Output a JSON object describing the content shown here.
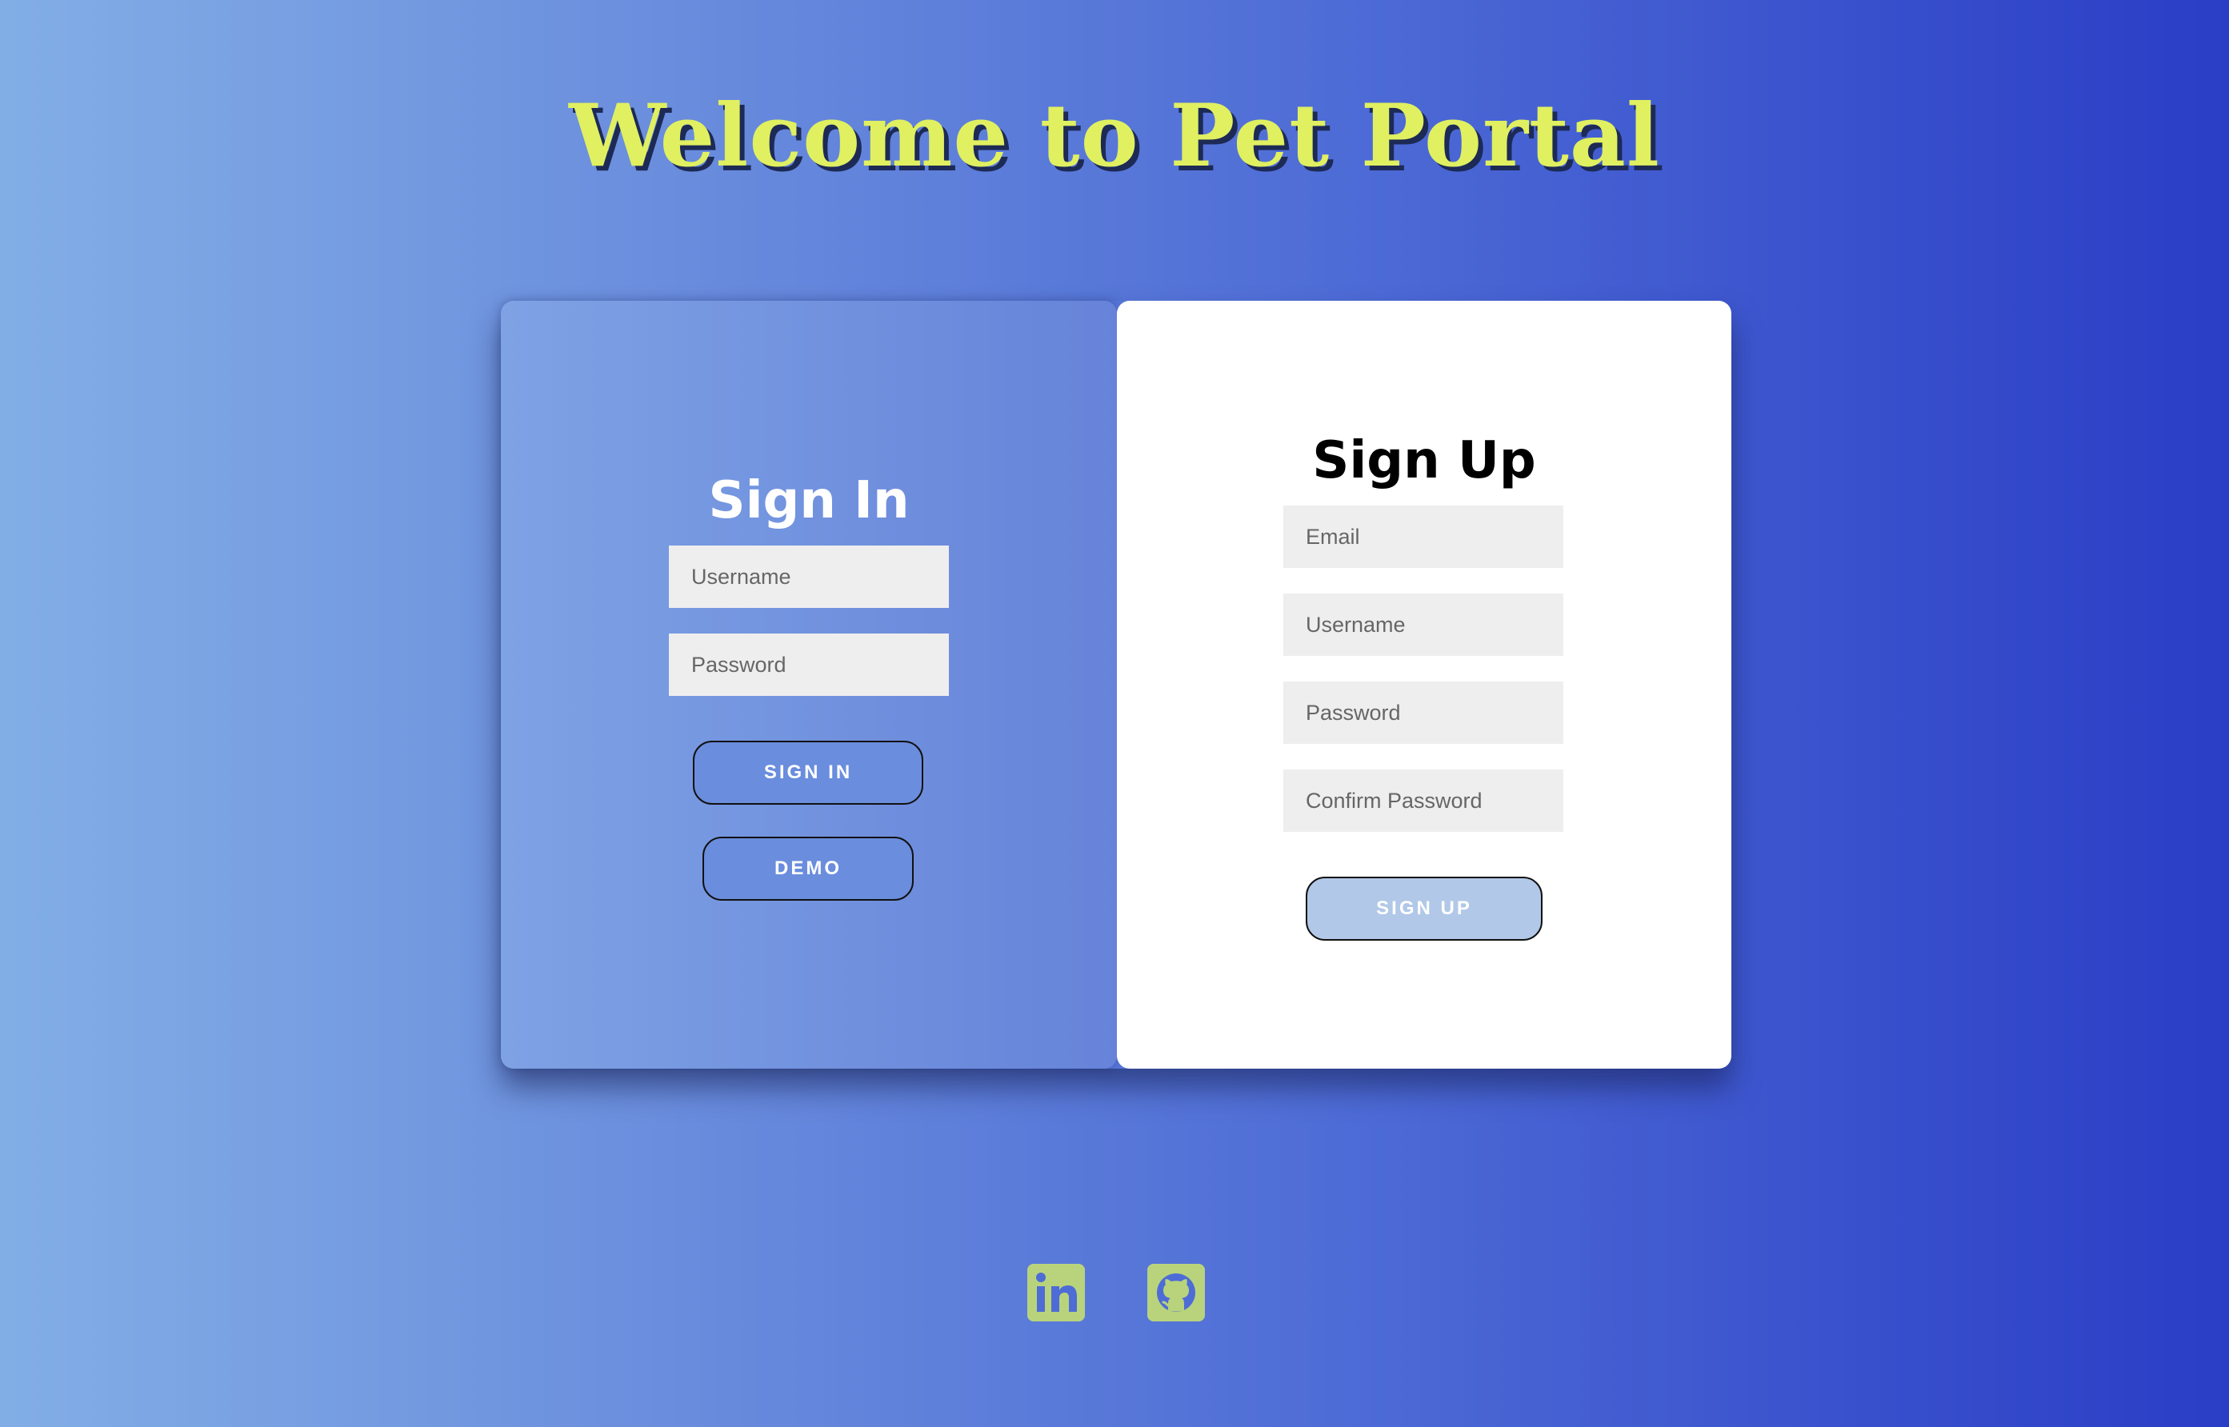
{
  "header": {
    "title": "Welcome to Pet Portal"
  },
  "sign_in": {
    "heading": "Sign In",
    "username_placeholder": "Username",
    "password_placeholder": "Password",
    "sign_in_label": "SIGN IN",
    "demo_label": "DEMO"
  },
  "sign_up": {
    "heading": "Sign Up",
    "email_placeholder": "Email",
    "username_placeholder": "Username",
    "password_placeholder": "Password",
    "confirm_password_placeholder": "Confirm Password",
    "sign_up_label": "SIGN UP"
  },
  "footer": {
    "icons": [
      "linkedin-icon",
      "github-icon"
    ]
  },
  "colors": {
    "title": "#e0f060",
    "icon_bg": "#b9d37c",
    "signin_button": "#6a8ddd",
    "signup_button": "#b1c8e8"
  }
}
